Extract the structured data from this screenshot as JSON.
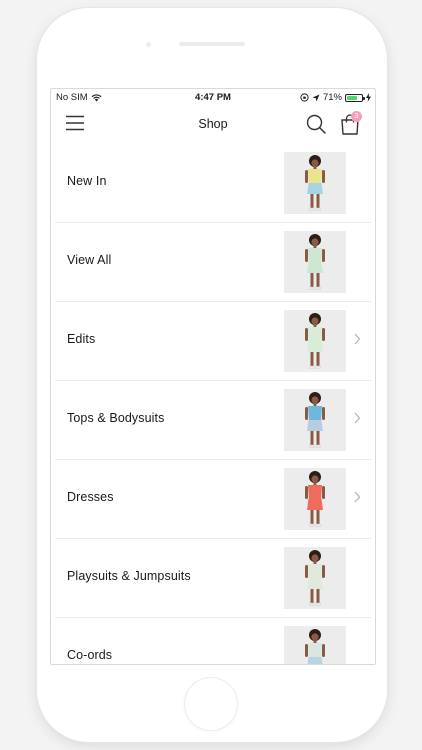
{
  "status_bar": {
    "carrier": "No SIM",
    "time": "4:47 PM",
    "battery_percent": "71%",
    "battery_level": 0.71,
    "battery_color": "#4cd964"
  },
  "nav": {
    "title": "Shop",
    "cart_count": "3",
    "badge_color": "#f5a2b8",
    "icons": [
      "menu-icon",
      "search-icon",
      "bag-icon"
    ]
  },
  "categories": [
    {
      "label": "New In",
      "has_chevron": false,
      "outfit": "#e9e58a",
      "bottom": "#a7d3e6"
    },
    {
      "label": "View All",
      "has_chevron": false,
      "outfit": "#cfe6d3",
      "bottom": "#cfe6d3"
    },
    {
      "label": "Edits",
      "has_chevron": true,
      "outfit": "#d8ecd8",
      "bottom": "#d8ecd8"
    },
    {
      "label": "Tops & Bodysuits",
      "has_chevron": true,
      "outfit": "#6fb7dd",
      "bottom": "#b8cde0"
    },
    {
      "label": "Dresses",
      "has_chevron": true,
      "outfit": "#ef6b5b",
      "bottom": "#ef6b5b"
    },
    {
      "label": "Playsuits & Jumpsuits",
      "has_chevron": false,
      "outfit": "#dfe9dc",
      "bottom": "#dfe9dc"
    },
    {
      "label": "Co-ords",
      "has_chevron": false,
      "outfit": "#d6e8e0",
      "bottom": "#b7d4e3"
    }
  ]
}
